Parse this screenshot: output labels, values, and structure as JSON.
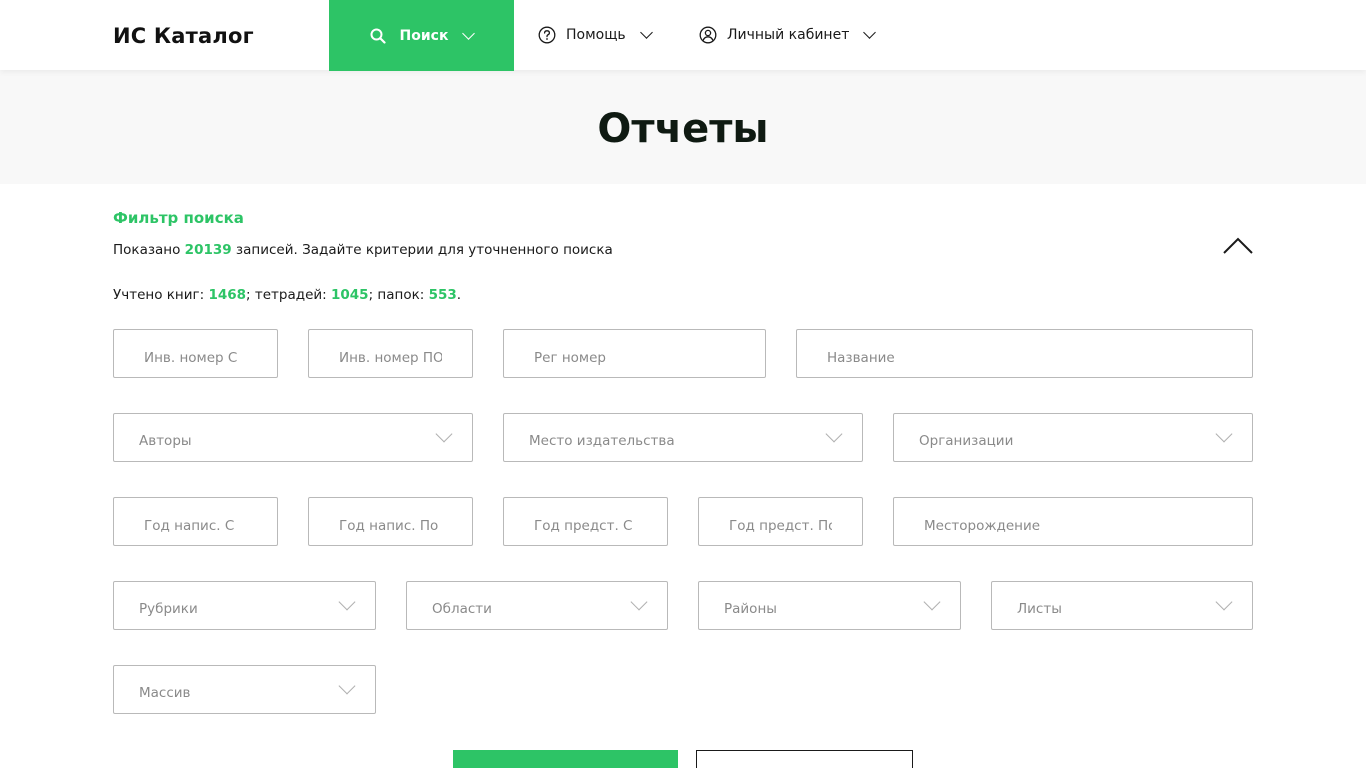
{
  "app": {
    "logo": "ИС Каталог"
  },
  "nav": {
    "search": "Поиск",
    "help": "Помощь",
    "cabinet": "Личный кабинет"
  },
  "page": {
    "title": "Отчеты"
  },
  "filter": {
    "title": "Фильтр поиска",
    "shown_prefix": "Показано ",
    "shown_count": "20139",
    "shown_suffix": " записей. Задайте критерии для уточненного поиска",
    "stats_books_label": "Учтено книг: ",
    "stats_books": "1468",
    "stats_notebooks_label": "; тетрадей: ",
    "stats_notebooks": "1045",
    "stats_folders_label": "; папок: ",
    "stats_folders": "553",
    "stats_end": "."
  },
  "fields": {
    "inv_from": "Инв. номер С",
    "inv_to": "Инв. номер ПО",
    "reg_number": "Рег номер",
    "name": "Название",
    "authors": "Авторы",
    "publish_place": "Место издательства",
    "organizations": "Организации",
    "year_written_from": "Год напис. С",
    "year_written_to": "Год напис. По",
    "year_submitted_from": "Год предст. С",
    "year_submitted_to": "Год предст. По",
    "deposit": "Месторождение",
    "rubrics": "Рубрики",
    "regions": "Области",
    "districts": "Районы",
    "sheets": "Листы",
    "massif": "Массив"
  },
  "colors": {
    "accent": "#2dc466",
    "border": "#b9b9b9",
    "band": "#f8f8f8"
  }
}
